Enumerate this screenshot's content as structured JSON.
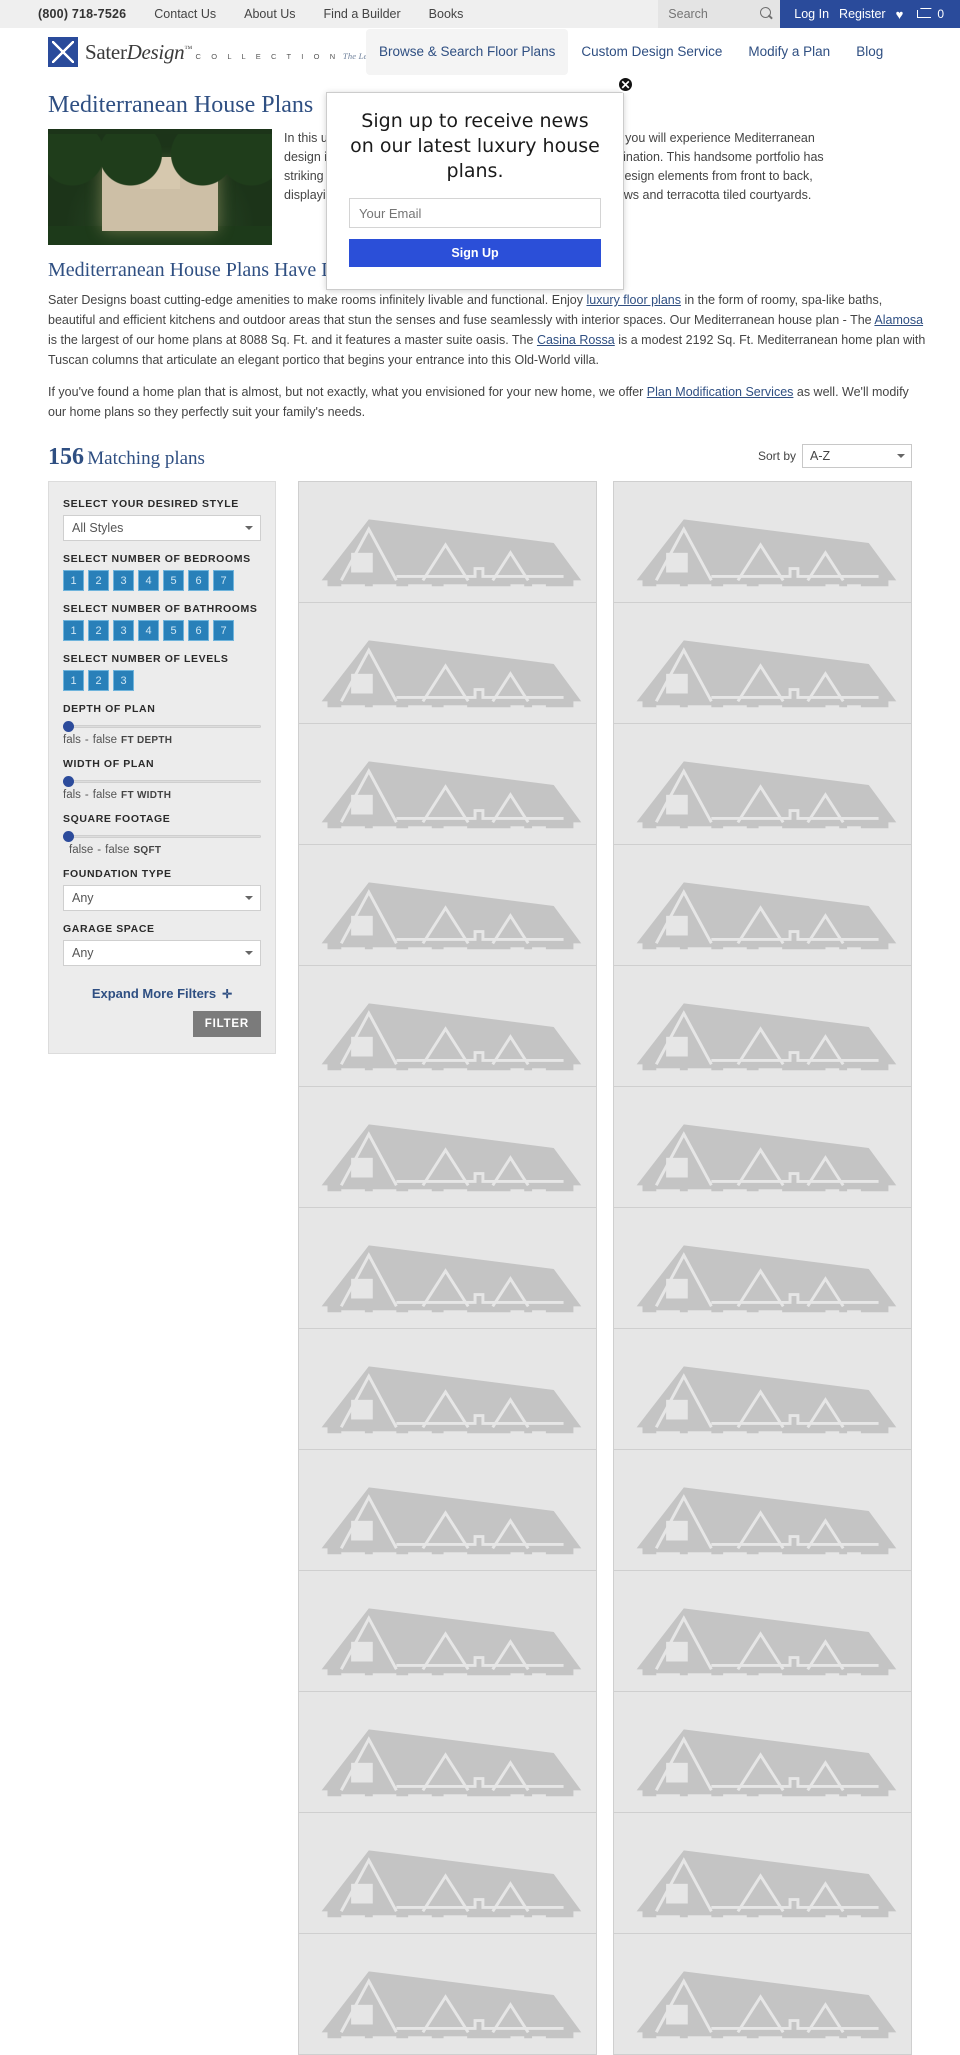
{
  "topbar": {
    "phone": "(800) 718-7526",
    "links": [
      "Contact Us",
      "About Us",
      "Find a Builder",
      "Books"
    ],
    "search_placeholder": "Search",
    "search_value": "",
    "search_icon": "search-icon",
    "login": "Log In",
    "register": "Register",
    "wishlist_icon": "heart-icon",
    "cart_icon": "cart-icon",
    "cart_count": "0"
  },
  "logo": {
    "line1_a": "Sater",
    "line1_b": "Design",
    "tm": "™",
    "line2": "C O L L E C T I O N",
    "tagline": "The Leader in Luxury Home Plans"
  },
  "mainnav": {
    "items": [
      {
        "label": "Browse & Search Floor Plans",
        "active": true
      },
      {
        "label": "Custom Design Service",
        "active": false
      },
      {
        "label": "Modify a Plan",
        "active": false
      },
      {
        "label": "Blog",
        "active": false
      }
    ]
  },
  "content": {
    "page_title": "Mediterranean House Plans",
    "intro_lines": [
      "In this unmatched collection from the Sater Design Collection you will experience Mediterranean",
      "design in a way that is sure to excite and encourage the imagination. This handsome portfolio has",
      "striking exteriors and floor plans that incorporate pure home design elements from front to back,",
      "displaying signature courtyard entries, dramatic arched windows and terracotta tiled courtyards."
    ],
    "sub_title": "Mediterranean House Plans Have Distinctive Details",
    "para1_pre": "Sater Designs boast cutting-edge amenities to make rooms infinitely livable and functional. Enjoy ",
    "para1_link1": "luxury floor plans",
    "para1_mid1": " in the form of roomy, spa-like baths, beautiful and efficient kitchens and outdoor areas that stun the senses and fuse seamlessly with interior spaces. Our Mediterranean house plan - The ",
    "para1_link2": "Alamosa",
    "para1_mid2": " is the largest of our home plans at 8088 Sq. Ft. and it features a master suite oasis. The ",
    "para1_link3": "Casina Rossa",
    "para1_end": " is a modest 2192 Sq. Ft. Mediterranean home plan with Tuscan columns that articulate an elegant portico that begins your entrance into this Old-World villa.",
    "para2_pre": "If you've found a home plan that is almost, but not exactly, what you envisioned for your new home, we offer ",
    "para2_link": "Plan Modification Services",
    "para2_end": " as well. We'll modify our home plans so they perfectly suit your family's needs."
  },
  "results": {
    "count": "156",
    "count_label": "Matching plans",
    "sort_label": "Sort by",
    "sort_value": "A-Z",
    "card_count": 26
  },
  "filters": {
    "style_label": "SELECT YOUR DESIRED STYLE",
    "style_value": "All Styles",
    "bedrooms_label": "SELECT NUMBER OF BEDROOMS",
    "bedrooms_options": [
      "1",
      "2",
      "3",
      "4",
      "5",
      "6",
      "7"
    ],
    "bathrooms_label": "SELECT NUMBER OF BATHROOMS",
    "bathrooms_options": [
      "1",
      "2",
      "3",
      "4",
      "5",
      "6",
      "7"
    ],
    "levels_label": "SELECT NUMBER OF LEVELS",
    "levels_options": [
      "1",
      "2",
      "3"
    ],
    "depth_label": "DEPTH OF PLAN",
    "depth_min": "fals",
    "depth_max": "false",
    "depth_unit": "FT DEPTH",
    "width_label": "WIDTH OF PLAN",
    "width_min": "fals",
    "width_max": "false",
    "width_unit": "FT WIDTH",
    "sqft_label": "SQUARE FOOTAGE",
    "sqft_min": "false",
    "sqft_max": "false",
    "sqft_unit": "SQFT",
    "foundation_label": "FOUNDATION TYPE",
    "foundation_value": "Any",
    "garage_label": "GARAGE SPACE",
    "garage_value": "Any",
    "expand_label": "Expand More Filters",
    "expand_icon": "chevron-down-icon",
    "filter_button": "FILTER",
    "dash": "-"
  },
  "modal": {
    "headline": "Sign up to receive news on our latest luxury house plans.",
    "email_placeholder": "Your Email",
    "email_value": "",
    "signup_label": "Sign Up",
    "close_icon": "close-icon",
    "close_glyph": "✕"
  },
  "colors": {
    "brand_blue": "#2a4b9b",
    "link_blue": "#2f4f82",
    "accent_blue": "#2980b9",
    "modal_button": "#2b4fd8",
    "filter_button": "#7b7b7b",
    "panel_bg": "#ececec",
    "card_bg": "#e6e6e6"
  }
}
